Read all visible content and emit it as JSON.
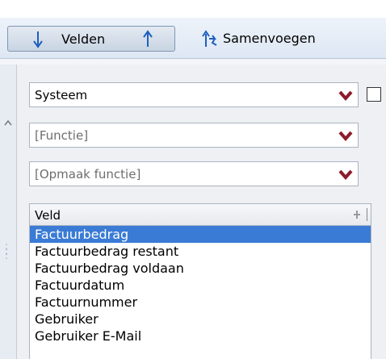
{
  "toolbar": {
    "velden_label": "Velden",
    "samenvoegen_label": "Samenvoegen"
  },
  "selects": {
    "systeem": "Systeem",
    "functie": "[Functie]",
    "opmaak": "[Opmaak functie]"
  },
  "list": {
    "header": "Veld",
    "items": [
      "Factuurbedrag",
      "Factuurbedrag restant",
      "Factuurbedrag voldaan",
      "Factuurdatum",
      "Factuurnummer",
      "Gebruiker",
      "Gebruiker E-Mail"
    ],
    "selected_index": 0
  },
  "colors": {
    "accent_blue": "#1f5fbf",
    "dropdown_arrow": "#8b1b2b",
    "selection": "#3a7bd5"
  },
  "icons": [
    "arrow-down-icon",
    "arrow-up-icon",
    "merge-icon",
    "chevron-down-icon",
    "pin-icon"
  ]
}
